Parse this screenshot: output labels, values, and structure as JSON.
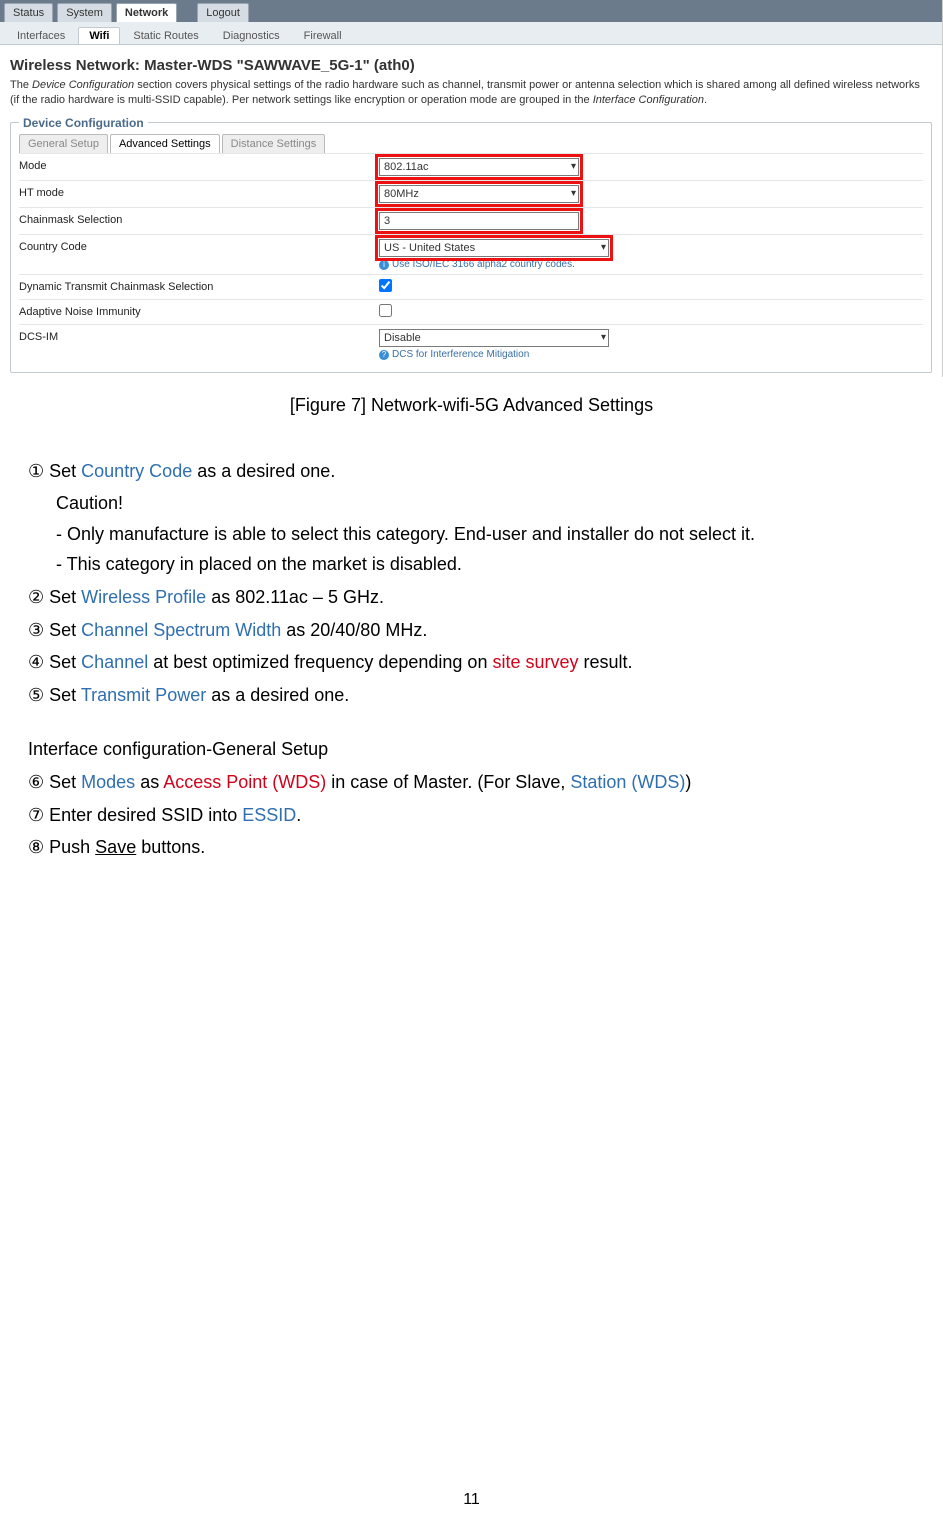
{
  "top_tabs": {
    "status": "Status",
    "system": "System",
    "network": "Network",
    "logout": "Logout"
  },
  "sub_tabs": {
    "interfaces": "Interfaces",
    "wifi": "Wifi",
    "static": "Static Routes",
    "diag": "Diagnostics",
    "fw": "Firewall"
  },
  "title": "Wireless Network: Master-WDS \"SAWWAVE_5G-1\" (ath0)",
  "desc_a": "The ",
  "desc_b": "Device Configuration",
  "desc_c": " section covers physical settings of the radio hardware such as channel, transmit power or antenna selection which is shared among all defined wireless networks (if the radio hardware is multi-SSID capable). Per network settings like encryption or operation mode are grouped in the ",
  "desc_d": "Interface Configuration",
  "desc_e": ".",
  "legend": "Device Configuration",
  "inner_tabs": {
    "gs": "General Setup",
    "adv": "Advanced Settings",
    "dist": "Distance Settings"
  },
  "rows": {
    "mode": {
      "label": "Mode",
      "value": "802.11ac"
    },
    "ht": {
      "label": "HT mode",
      "value": "80MHz"
    },
    "chain": {
      "label": "Chainmask Selection",
      "value": "3"
    },
    "cc": {
      "label": "Country Code",
      "value": "US - United States",
      "hint": "Use ISO/IEC 3166 alpha2 country codes."
    },
    "dyn": {
      "label": "Dynamic Transmit Chainmask Selection",
      "checked": true
    },
    "ani": {
      "label": "Adaptive Noise Immunity",
      "checked": false
    },
    "dcs": {
      "label": "DCS-IM",
      "value": "Disable",
      "hint": "DCS for Interference Mitigation"
    }
  },
  "caption": "[Figure 7] Network-wifi-5G Advanced Settings",
  "body": {
    "l1a": "① Set ",
    "l1b": "Country Code",
    "l1c": " as a desired one.",
    "caut": "Caution!",
    "c1": "- Only manufacture is able to select this category. End-user and installer do not select it.",
    "c2": "- This category in placed on the market is disabled.",
    "l2a": "② Set ",
    "l2b": "Wireless Profile",
    "l2c": " as 802.11ac – 5 GHz.",
    "l3a": "③ Set ",
    "l3b": "Channel Spectrum Width",
    "l3c": " as 20/40/80 MHz.",
    "l4a": "④ Set ",
    "l4b": "Channel",
    "l4c": " at best optimized frequency depending on ",
    "l4d": "site survey",
    "l4e": " result.",
    "l5a": "⑤ Set ",
    "l5b": "Transmit Power",
    "l5c": " as a desired one.",
    "ifhdr": "Interface configuration-General Setup",
    "l6a": "⑥ Set ",
    "l6b": "Modes",
    "l6c": " as ",
    "l6d": "Access Point (WDS)",
    "l6e": " in case of Master. (For Slave, ",
    "l6f": "Station (WDS)",
    "l6g": ")",
    "l7a": "⑦ Enter desired SSID into ",
    "l7b": "ESSID",
    "l7c": ".",
    "l8a": "⑧ Push ",
    "l8b": "Save",
    "l8c": " buttons."
  },
  "page_number": "11"
}
